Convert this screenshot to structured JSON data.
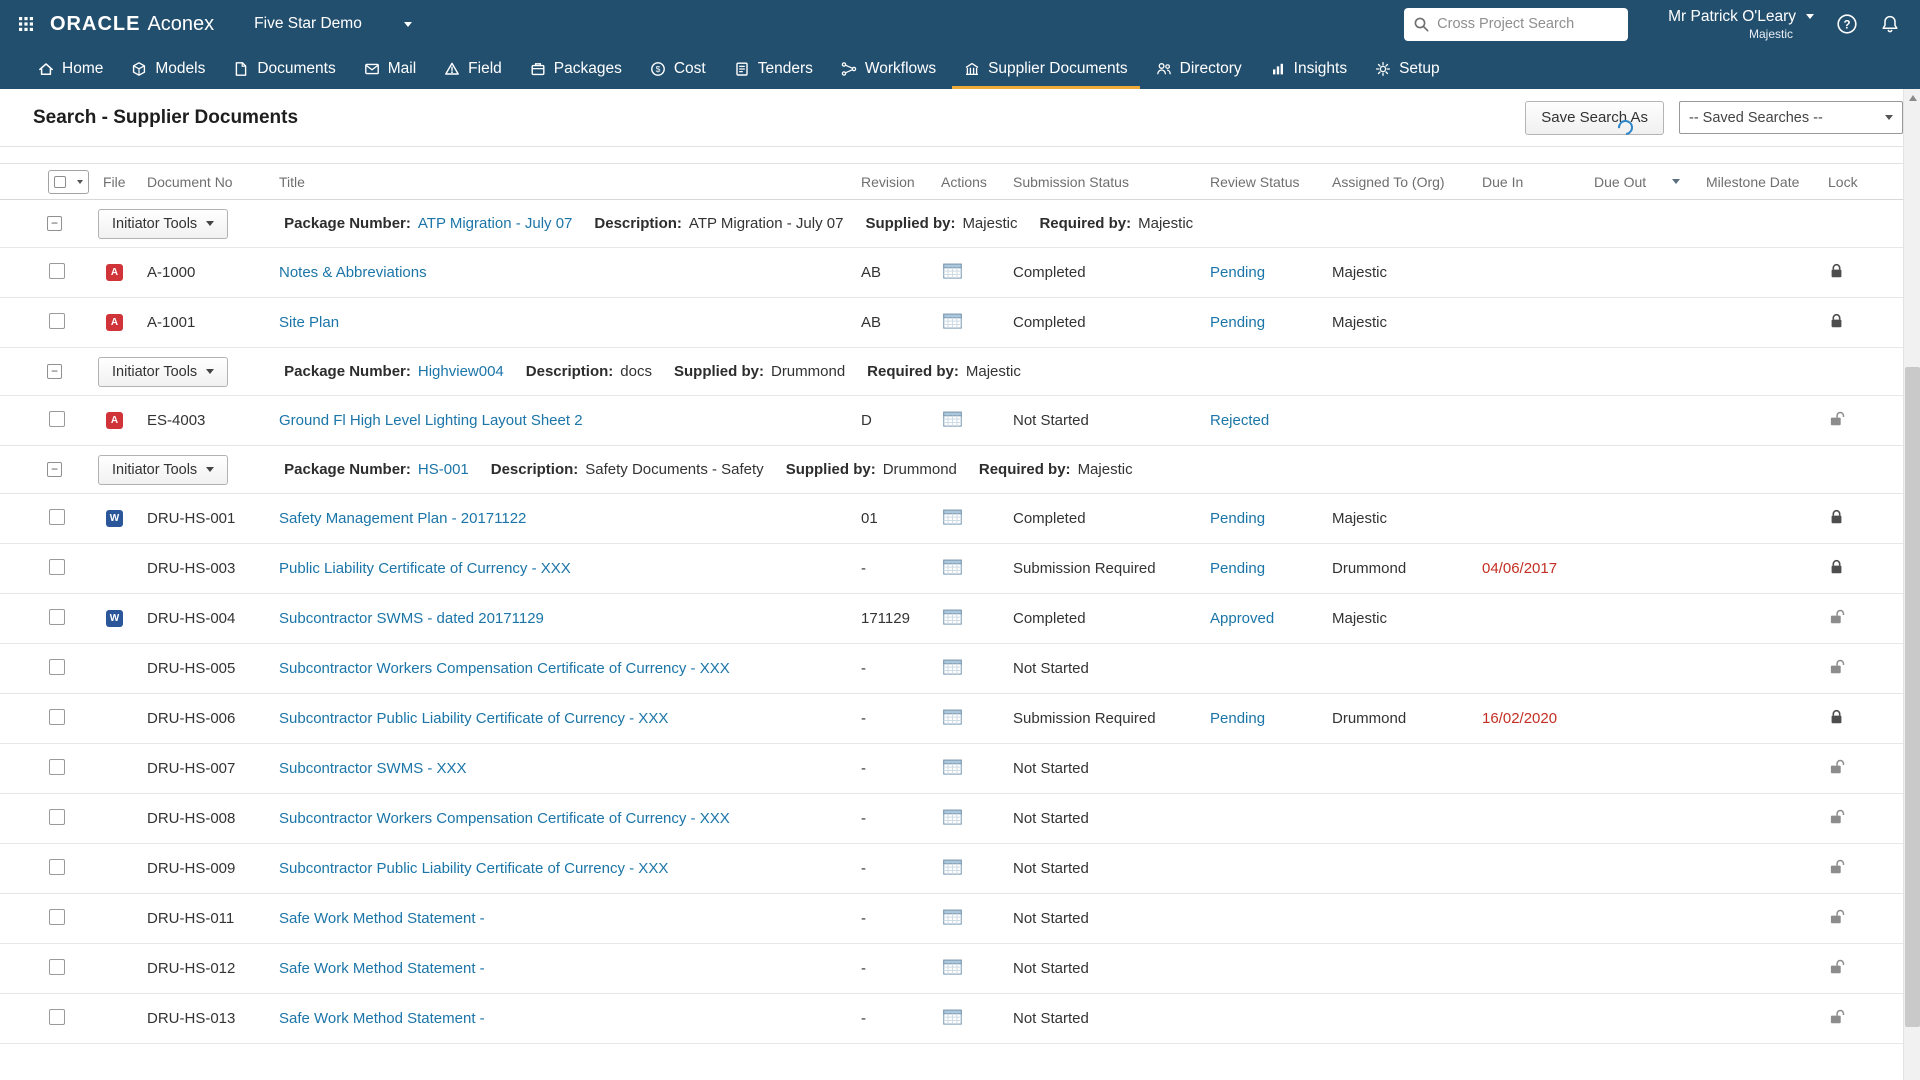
{
  "colors": {
    "header_bg": "#234f6f",
    "accent": "#efaa3a",
    "link": "#1b75a8",
    "overdue": "#c42f24",
    "text": "#333333"
  },
  "header": {
    "brand_oracle": "ORACLE",
    "brand_product": "Aconex",
    "project_name": "Five Star Demo",
    "search_placeholder": "Cross Project Search",
    "user_name": "Mr Patrick O'Leary",
    "user_org": "Majestic"
  },
  "nav": {
    "items": [
      {
        "label": "Home",
        "icon": "home-icon",
        "active": false
      },
      {
        "label": "Models",
        "icon": "models-icon",
        "active": false
      },
      {
        "label": "Documents",
        "icon": "documents-icon",
        "active": false
      },
      {
        "label": "Mail",
        "icon": "mail-icon",
        "active": false
      },
      {
        "label": "Field",
        "icon": "field-icon",
        "active": false
      },
      {
        "label": "Packages",
        "icon": "packages-icon",
        "active": false
      },
      {
        "label": "Cost",
        "icon": "cost-icon",
        "active": false
      },
      {
        "label": "Tenders",
        "icon": "tenders-icon",
        "active": false
      },
      {
        "label": "Workflows",
        "icon": "workflows-icon",
        "active": false
      },
      {
        "label": "Supplier Documents",
        "icon": "supplier-documents-icon",
        "active": true
      },
      {
        "label": "Directory",
        "icon": "directory-icon",
        "active": false
      },
      {
        "label": "Insights",
        "icon": "insights-icon",
        "active": false
      },
      {
        "label": "Setup",
        "icon": "setup-icon",
        "active": false
      }
    ]
  },
  "toolbar": {
    "page_title": "Search - Supplier Documents",
    "save_search_button": "Save Search As",
    "saved_searches_value": "-- Saved Searches --"
  },
  "table": {
    "columns": {
      "file": "File",
      "document_no": "Document No",
      "title": "Title",
      "revision": "Revision",
      "actions": "Actions",
      "submission_status": "Submission Status",
      "review_status": "Review Status",
      "assigned_to": "Assigned To (Org)",
      "due_in": "Due In",
      "due_out": "Due Out",
      "milestone_date": "Milestone Date",
      "lock": "Lock"
    },
    "labels": {
      "initiator_tools": "Initiator Tools",
      "package_number": "Package Number:",
      "description": "Description:",
      "supplied_by": "Supplied by:",
      "required_by": "Required by:"
    },
    "groups": [
      {
        "package_number": "ATP Migration - July 07",
        "description": "ATP Migration - July 07",
        "supplied_by": "Majestic",
        "required_by": "Majestic",
        "rows": [
          {
            "file_type": "pdf",
            "document_no": "A-1000",
            "title": "Notes & Abbreviations",
            "revision": "AB",
            "submission_status": "Completed",
            "review_status": "Pending",
            "assigned_to_org": "Majestic",
            "due_in": "",
            "locked": true
          },
          {
            "file_type": "pdf",
            "document_no": "A-1001",
            "title": "Site Plan",
            "revision": "AB",
            "submission_status": "Completed",
            "review_status": "Pending",
            "assigned_to_org": "Majestic",
            "due_in": "",
            "locked": true
          }
        ]
      },
      {
        "package_number": "Highview004",
        "description": "docs",
        "supplied_by": "Drummond",
        "required_by": "Majestic",
        "rows": [
          {
            "file_type": "pdf",
            "document_no": "ES-4003",
            "title": "Ground Fl High Level Lighting Layout Sheet 2",
            "revision": "D",
            "submission_status": "Not Started",
            "review_status": "Rejected",
            "assigned_to_org": "",
            "due_in": "",
            "locked": false
          }
        ]
      },
      {
        "package_number": "HS-001",
        "description": "Safety Documents - Safety",
        "supplied_by": "Drummond",
        "required_by": "Majestic",
        "rows": [
          {
            "file_type": "word",
            "document_no": "DRU-HS-001",
            "title": "Safety Management Plan - 20171122",
            "revision": "01",
            "submission_status": "Completed",
            "review_status": "Pending",
            "assigned_to_org": "Majestic",
            "due_in": "",
            "locked": true
          },
          {
            "file_type": "",
            "document_no": "DRU-HS-003",
            "title": "Public Liability Certificate of Currency - XXX",
            "revision": "-",
            "submission_status": "Submission Required",
            "review_status": "Pending",
            "assigned_to_org": "Drummond",
            "due_in": "04/06/2017",
            "locked": true
          },
          {
            "file_type": "word",
            "document_no": "DRU-HS-004",
            "title": "Subcontractor SWMS - dated 20171129",
            "revision": "171129",
            "submission_status": "Completed",
            "review_status": "Approved",
            "assigned_to_org": "Majestic",
            "due_in": "",
            "locked": false
          },
          {
            "file_type": "",
            "document_no": "DRU-HS-005",
            "title": "Subcontractor Workers Compensation Certificate of Currency - XXX",
            "revision": "-",
            "submission_status": "Not Started",
            "review_status": "",
            "assigned_to_org": "",
            "due_in": "",
            "locked": false
          },
          {
            "file_type": "",
            "document_no": "DRU-HS-006",
            "title": "Subcontractor Public Liability Certificate of Currency - XXX",
            "revision": "-",
            "submission_status": "Submission Required",
            "review_status": "Pending",
            "assigned_to_org": "Drummond",
            "due_in": "16/02/2020",
            "locked": true
          },
          {
            "file_type": "",
            "document_no": "DRU-HS-007",
            "title": "Subcontractor SWMS - XXX",
            "revision": "-",
            "submission_status": "Not Started",
            "review_status": "",
            "assigned_to_org": "",
            "due_in": "",
            "locked": false
          },
          {
            "file_type": "",
            "document_no": "DRU-HS-008",
            "title": "Subcontractor Workers Compensation Certificate of Currency - XXX",
            "revision": "-",
            "submission_status": "Not Started",
            "review_status": "",
            "assigned_to_org": "",
            "due_in": "",
            "locked": false
          },
          {
            "file_type": "",
            "document_no": "DRU-HS-009",
            "title": "Subcontractor Public Liability Certificate of Currency - XXX",
            "revision": "-",
            "submission_status": "Not Started",
            "review_status": "",
            "assigned_to_org": "",
            "due_in": "",
            "locked": false
          },
          {
            "file_type": "",
            "document_no": "DRU-HS-011",
            "title": "Safe Work Method Statement -",
            "revision": "-",
            "submission_status": "Not Started",
            "review_status": "",
            "assigned_to_org": "",
            "due_in": "",
            "locked": false
          },
          {
            "file_type": "",
            "document_no": "DRU-HS-012",
            "title": "Safe Work Method Statement -",
            "revision": "-",
            "submission_status": "Not Started",
            "review_status": "",
            "assigned_to_org": "",
            "due_in": "",
            "locked": false
          },
          {
            "file_type": "",
            "document_no": "DRU-HS-013",
            "title": "Safe Work Method Statement -",
            "revision": "-",
            "submission_status": "Not Started",
            "review_status": "",
            "assigned_to_org": "",
            "due_in": "",
            "locked": false
          }
        ]
      }
    ]
  }
}
